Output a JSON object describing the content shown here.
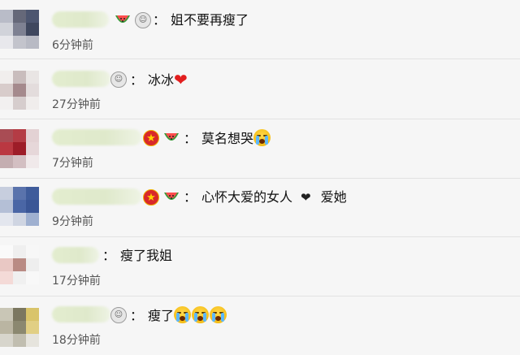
{
  "comments": [
    {
      "badges": [
        "melon",
        "medal"
      ],
      "colon": "：",
      "text": "姐不要再瘦了",
      "time": "6分钟前",
      "avatar": [
        "#b9bcc8",
        "#656879",
        "#4d5670",
        "#d1d3da",
        "#7e8192",
        "#3f475e",
        "#e8e8ec",
        "#c3c4cc",
        "#b8bac4"
      ]
    },
    {
      "badges": [
        "medal"
      ],
      "colon": "：",
      "text": "冰冰",
      "emoji": "❤",
      "time": "27分钟前",
      "avatar": [
        "#f1eeed",
        "#c9bdbd",
        "#e9e5e4",
        "#d8cccb",
        "#a58a8d",
        "#e3dcdc",
        "#f2f0f0",
        "#d6cdcd",
        "#f0edec"
      ]
    },
    {
      "badges": [
        "star",
        "melon"
      ],
      "colon": "：",
      "text": "莫名想哭",
      "time": "7分钟前",
      "avatar": [
        "#a94c54",
        "#b43c45",
        "#e3d2d4",
        "#ba3841",
        "#9d1d28",
        "#e6d7d9",
        "#c4aeb1",
        "#d3bfc2",
        "#f0e9ea"
      ]
    },
    {
      "badges": [
        "star",
        "melon"
      ],
      "colon": "：",
      "text": "心怀大爱的女人",
      "text_after": "爱她",
      "time": "9分钟前",
      "avatar": [
        "#c7cede",
        "#5a73ac",
        "#3f5c9b",
        "#b4bfd6",
        "#4a66a5",
        "#3a5696",
        "#e3e6ee",
        "#cfd5e2",
        "#9fb0d0"
      ]
    },
    {
      "badges": [],
      "colon": "",
      "text": "瘦了我姐",
      "time": "17分钟前",
      "avatar": [
        "#fafafa",
        "#efefef",
        "#f7f7f7",
        "#e9c8c4",
        "#b98b84",
        "#eeeeee",
        "#f4dad7",
        "#f0f0f0",
        "#f8f8f8"
      ]
    },
    {
      "badges": [
        "medal"
      ],
      "colon": "：",
      "text": "瘦了",
      "time": "18分钟前",
      "avatar": [
        "#c9c6b6",
        "#7b7760",
        "#d9c46a",
        "#bab5a2",
        "#8b8870",
        "#e1cf84",
        "#d7d5cc",
        "#c1beb0",
        "#e6e4dd"
      ]
    }
  ],
  "colors": {
    "background": "#f6f6f6",
    "divider": "#e2e2e2",
    "time_text": "#555555",
    "heart": "#e21e1e"
  }
}
